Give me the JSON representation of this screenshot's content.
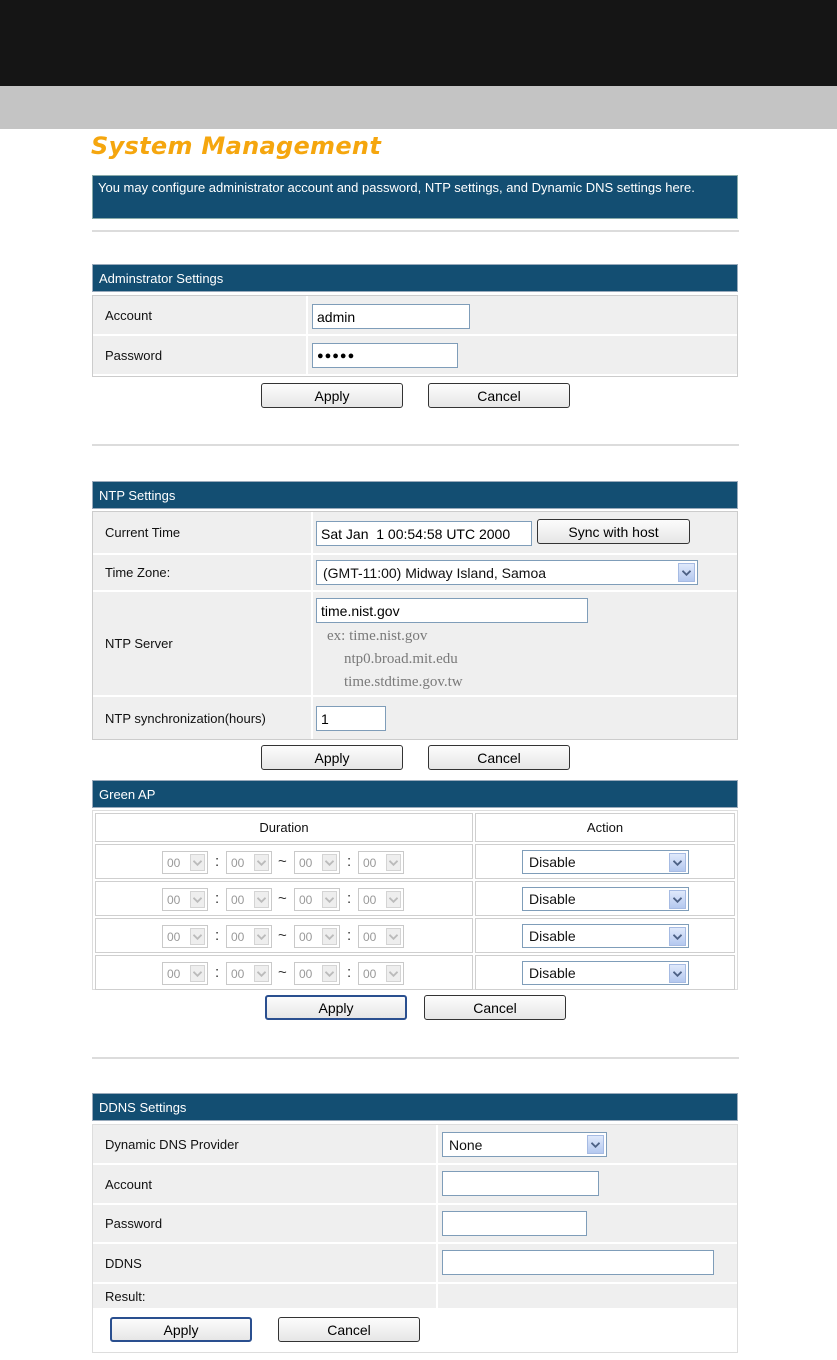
{
  "page_title": "System Management",
  "intro": "You may configure administrator account and password, NTP settings, and Dynamic DNS settings here.",
  "admin": {
    "header": "Adminstrator Settings",
    "account_label": "Account",
    "account_value": "admin",
    "password_label": "Password",
    "password_value": "●●●●●",
    "apply": "Apply",
    "cancel": "Cancel"
  },
  "ntp": {
    "header": "NTP Settings",
    "current_time_label": "Current Time",
    "current_time_value": "Sat Jan  1 00:54:58 UTC 2000",
    "sync_button": "Sync with host",
    "timezone_label": "Time Zone:",
    "timezone_value": "(GMT-11:00) Midway Island, Samoa",
    "server_label": "NTP Server",
    "server_value": "time.nist.gov",
    "hint_1": "ex: time.nist.gov",
    "hint_2": "ntp0.broad.mit.edu",
    "hint_3": "time.stdtime.gov.tw",
    "sync_hours_label": "NTP synchronization(hours)",
    "sync_hours_value": "1",
    "apply": "Apply",
    "cancel": "Cancel"
  },
  "green": {
    "header": "Green AP",
    "col_duration": "Duration",
    "col_action": "Action",
    "rows": [
      {
        "h1": "00",
        "m1": "00",
        "h2": "00",
        "m2": "00",
        "action": "Disable"
      },
      {
        "h1": "00",
        "m1": "00",
        "h2": "00",
        "m2": "00",
        "action": "Disable"
      },
      {
        "h1": "00",
        "m1": "00",
        "h2": "00",
        "m2": "00",
        "action": "Disable"
      },
      {
        "h1": "00",
        "m1": "00",
        "h2": "00",
        "m2": "00",
        "action": "Disable"
      }
    ],
    "colon": ":",
    "tilde": "~",
    "apply": "Apply",
    "cancel": "Cancel"
  },
  "ddns": {
    "header": "DDNS Settings",
    "provider_label": "Dynamic DNS Provider",
    "provider_value": "None",
    "account_label": "Account",
    "account_value": "",
    "password_label": "Password",
    "password_value": "",
    "ddns_label": "DDNS",
    "ddns_value": "",
    "result_label": "Result:",
    "apply": "Apply",
    "cancel": "Cancel"
  },
  "icons": {
    "dropdown_arrow": "chevron-down-icon"
  }
}
